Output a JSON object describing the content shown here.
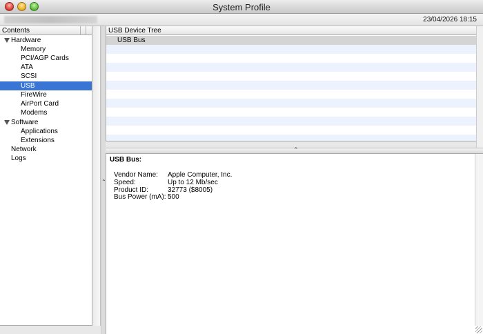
{
  "window": {
    "title": "System Profile"
  },
  "infobar": {
    "date": "23/04/2026 18:15"
  },
  "sidebar": {
    "header": "Contents",
    "items": [
      {
        "label": "Hardware",
        "expanded": true
      },
      {
        "label": "Memory"
      },
      {
        "label": "PCI/AGP Cards"
      },
      {
        "label": "ATA"
      },
      {
        "label": "SCSI"
      },
      {
        "label": "USB",
        "selected": true
      },
      {
        "label": "FireWire"
      },
      {
        "label": "AirPort Card"
      },
      {
        "label": "Modems"
      },
      {
        "label": "Software",
        "expanded": true
      },
      {
        "label": "Applications"
      },
      {
        "label": "Extensions"
      },
      {
        "label": "Network"
      },
      {
        "label": "Logs"
      }
    ]
  },
  "device_tree": {
    "header": "USB Device Tree",
    "rows": [
      {
        "label": "USB Bus",
        "selected": true
      }
    ]
  },
  "detail": {
    "title": "USB Bus:",
    "fields": [
      {
        "key": "Vendor Name:",
        "value": "Apple Computer, Inc."
      },
      {
        "key": "Speed:",
        "value": "Up to 12 Mb/sec"
      },
      {
        "key": "Product ID:",
        "value": "32773 ($8005)"
      },
      {
        "key": "Bus Power (mA):",
        "value": "500"
      }
    ]
  },
  "colors": {
    "selection": "#3a75d6",
    "stripe": "#edf3fe",
    "row_selected": "#d4d4d4"
  }
}
